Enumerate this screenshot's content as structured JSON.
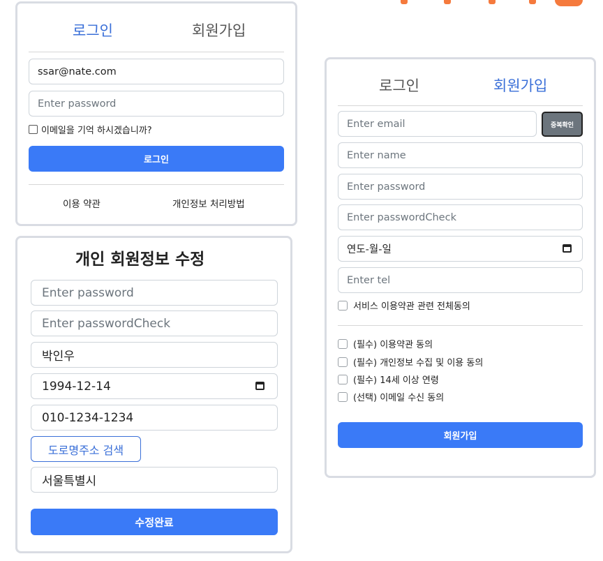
{
  "colors": {
    "accent": "#3a7af7",
    "tab_active": "#3a6fd8",
    "decoration": "#f57a3d",
    "secondary": "#6c757d"
  },
  "login_card": {
    "tab_login": "로그인",
    "tab_signup": "회원가입",
    "email_value": "ssar@nate.com",
    "password_placeholder": "Enter password",
    "remember_label": "이메일을 기억 하시겠습니까?",
    "login_button": "로그인",
    "terms_link": "이용 약관",
    "privacy_link": "개인정보 처리방법"
  },
  "edit_card": {
    "title": "개인 회원정보 수정",
    "password_placeholder": "Enter password",
    "password_check_placeholder": "Enter passwordCheck",
    "name_value": "박인우",
    "birth_value": "1994-12-14",
    "tel_value": "010-1234-1234",
    "address_search_button": "도로명주소 검색",
    "address_value": "서울특별시",
    "submit_button": "수정완료"
  },
  "signup_card": {
    "tab_login": "로그인",
    "tab_signup": "회원가입",
    "email_placeholder": "Enter email",
    "duplicate_check_button": "중복확인",
    "name_placeholder": "Enter name",
    "password_placeholder": "Enter password",
    "password_check_placeholder": "Enter passwordCheck",
    "date_placeholder": "연도-월-일",
    "tel_placeholder": "Enter tel",
    "agree_all_label": "서비스 이용약관 관련 전체동의",
    "agreements": [
      "(필수) 이용약관 동의",
      "(필수) 개인정보 수집 및 이용 동의",
      "(필수) 14세 이상 연령",
      "(선택) 이메일 수신 동의"
    ],
    "signup_button": "회원가입"
  }
}
